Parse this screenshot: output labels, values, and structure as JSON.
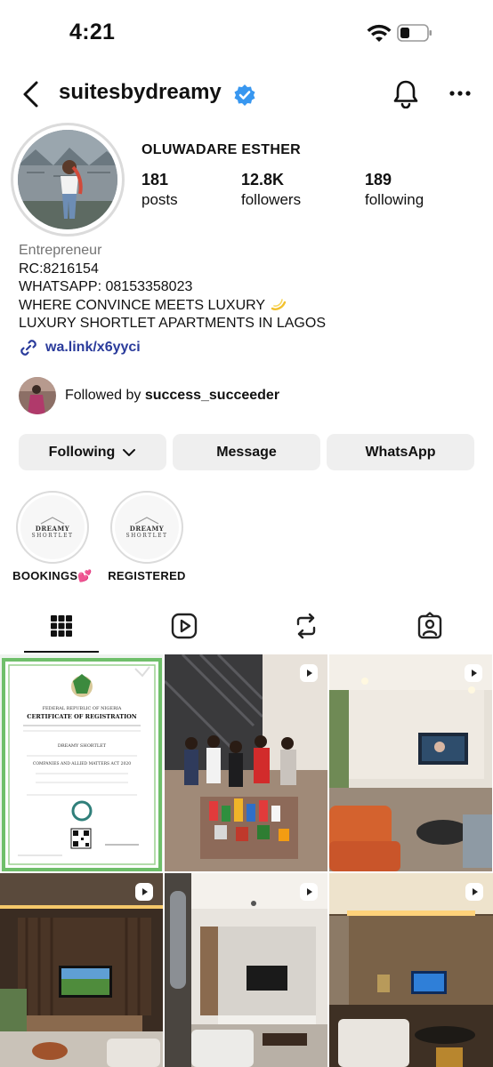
{
  "status_bar": {
    "time": "4:21"
  },
  "nav": {
    "username": "suitesbydreamy"
  },
  "profile": {
    "display_name": "OLUWADARE ESTHER",
    "stats": [
      {
        "number": "181",
        "label": "posts"
      },
      {
        "number": "12.8K",
        "label": "followers"
      },
      {
        "number": "189",
        "label": "following"
      }
    ],
    "bio": {
      "category": "Entrepreneur",
      "lines": [
        "RC:8216154",
        "WHATSAPP: 08153358023",
        "WHERE CONVINCE MEETS LUXURY",
        "LUXURY SHORTLET APARTMENTS IN LAGOS"
      ]
    },
    "link": "wa.link/x6yyci",
    "followed_by": {
      "prefix": "Followed by",
      "user": "success_succeeder"
    }
  },
  "buttons": {
    "following": "Following",
    "message": "Message",
    "whatsapp": "WhatsApp"
  },
  "highlights": [
    {
      "label": "BOOKINGS💕",
      "logo_top": "DREAMY",
      "logo_bottom": "SHORTLET"
    },
    {
      "label": "REGISTERED",
      "logo_top": "DREAMY",
      "logo_bottom": "SHORTLET"
    }
  ],
  "tabs": [
    "grid-icon",
    "reels-icon",
    "reposts-icon",
    "tagged-icon"
  ],
  "posts": [
    {
      "type": "certificate",
      "lines": [
        "FEDERAL REPUBLIC OF NIGERIA",
        "CERTIFICATE OF REGISTRATION",
        "DREAMY SHORTLET",
        "COMPANIES AND ALLIED MATTERS ACT 2020"
      ]
    },
    {
      "type": "reel",
      "subject": "group-photo"
    },
    {
      "type": "reel",
      "subject": "living-room-orange-sofa"
    },
    {
      "type": "reel",
      "subject": "living-room-tv-wall"
    },
    {
      "type": "reel",
      "subject": "living-room-tv-marble"
    },
    {
      "type": "reel",
      "subject": "living-room-gold-light"
    }
  ],
  "colors": {
    "verified": "#3897f0",
    "link": "#2a3b9b",
    "button_bg": "#efefef"
  }
}
